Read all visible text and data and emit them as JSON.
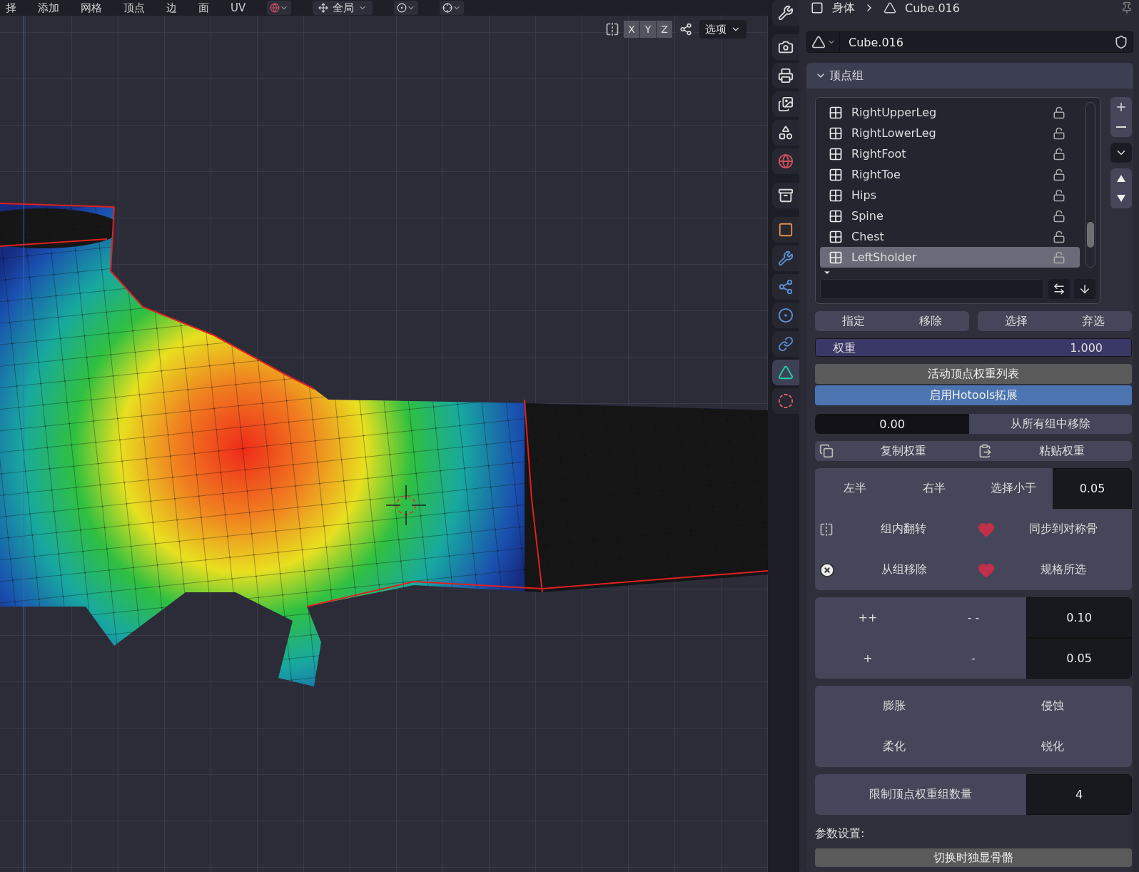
{
  "menu": [
    {
      "label": "择"
    },
    {
      "label": "添加"
    },
    {
      "label": "网格"
    },
    {
      "label": "顶点"
    },
    {
      "label": "边"
    },
    {
      "label": "面"
    },
    {
      "label": "UV"
    }
  ],
  "toolbar": {
    "orientation": "全局"
  },
  "viewport_header": {
    "axes": [
      "X",
      "Y",
      "Z"
    ],
    "options": "选项"
  },
  "breadcrumb": [
    "身体",
    "Cube.016"
  ],
  "sidebar_tabs": [
    {
      "kind": "tool",
      "selected": false
    },
    {
      "kind": "render",
      "selected": false
    },
    {
      "kind": "output",
      "selected": false
    },
    {
      "kind": "view",
      "selected": false
    },
    {
      "kind": "scene",
      "selected": false
    },
    {
      "kind": "world",
      "selected": false
    },
    {
      "kind": "collection",
      "selected": false
    },
    {
      "kind": "object",
      "selected": false
    },
    {
      "kind": "modifier",
      "selected": false
    },
    {
      "kind": "particles",
      "selected": false
    },
    {
      "kind": "physics",
      "selected": false
    },
    {
      "kind": "constraints",
      "selected": false
    },
    {
      "kind": "data",
      "selected": true
    },
    {
      "kind": "material",
      "selected": false
    }
  ],
  "mesh_field": "Cube.016",
  "panel": {
    "title": "顶点组",
    "expanded": true
  },
  "vertex_groups": [
    {
      "name": "RightUpperLeg",
      "selected": false
    },
    {
      "name": "RightLowerLeg",
      "selected": false
    },
    {
      "name": "RightFoot",
      "selected": false
    },
    {
      "name": "RightToe",
      "selected": false
    },
    {
      "name": "Hips",
      "selected": false
    },
    {
      "name": "Spine",
      "selected": false
    },
    {
      "name": "Chest",
      "selected": false
    },
    {
      "name": "LeftSholder",
      "selected": true
    }
  ],
  "group_buttons": [
    [
      "指定",
      "移除"
    ],
    [
      "选择",
      "弃选"
    ]
  ],
  "weight": {
    "label": "权重",
    "value": "1.000",
    "level": 1
  },
  "active_weight_list": {
    "label": "活动顶点权重列表",
    "on": false
  },
  "hotools": {
    "label": "启用Hotools拓展",
    "on": true
  },
  "remove_all": {
    "value": "0.00",
    "label": "从所有组中移除"
  },
  "copy_paste": [
    "复制权重",
    "粘贴权重"
  ],
  "mirror_block": {
    "buttons": [
      "左半",
      "右半",
      "选择小于"
    ],
    "threshold": "0.05",
    "actions": [
      {
        "kind": "mirror",
        "label": "组内翻转"
      },
      {
        "kind": "heart",
        "label": "同步到对称骨"
      },
      {
        "kind": "close",
        "label": "从组移除"
      },
      {
        "kind": "heart",
        "label": "规格所选"
      }
    ]
  },
  "increment": [
    {
      "buttons": [
        "++",
        "- -"
      ],
      "value": "0.10"
    },
    {
      "buttons": [
        "+",
        "-"
      ],
      "value": "0.05"
    }
  ],
  "smooth": [
    "膨胀",
    "侵蚀",
    "柔化",
    "锐化"
  ],
  "limit": {
    "label": "限制顶点权重组数量",
    "value": "4"
  },
  "settings_label": "参数设置:",
  "solo_button": "切换时独显骨骼"
}
